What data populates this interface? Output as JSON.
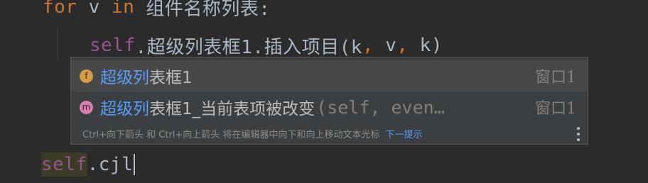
{
  "editor": {
    "line1": {
      "kw_for": "for",
      "var": " v ",
      "kw_in": "in",
      "rest": " 组件名称列表:"
    },
    "line2": {
      "self": "self",
      "rest": ".超级列表框1.插入项目(k",
      "comma1": ",",
      "v": " v",
      "comma2": ",",
      "k_end": " k)"
    },
    "line4": {
      "self": "self",
      "typed": ".cjl"
    }
  },
  "completion": {
    "items": [
      {
        "badge": "f",
        "match": "超级列",
        "rest": "表框1",
        "signature": "",
        "origin": "窗口1"
      },
      {
        "badge": "m",
        "match": "超级列",
        "rest": "表框1_当前表项被改变",
        "signature": "(self, even…",
        "origin": "窗口1"
      }
    ],
    "footer": {
      "hint": "Ctrl+向下箭头 和 Ctrl+向上箭头 将在编辑器中向下和向上移动文本光标",
      "link": "下一提示"
    }
  },
  "icons": {
    "more": "more-vertical-icon"
  },
  "colors": {
    "background": "#2b2b2b",
    "keyword": "#cc7832",
    "self": "#94558d",
    "text": "#a9b7c6",
    "match": "#589df6",
    "popup_bg": "#3c3f41",
    "popup_selected": "#46484a"
  }
}
